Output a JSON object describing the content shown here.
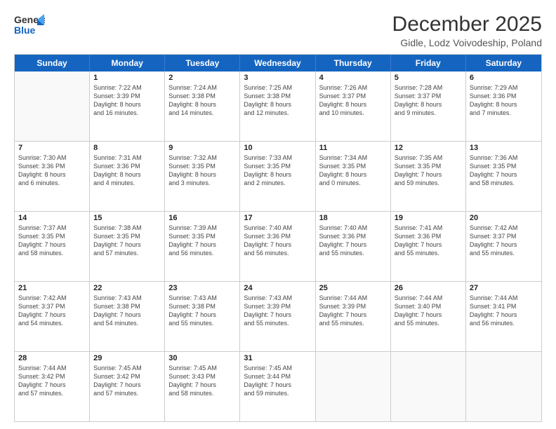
{
  "logo": {
    "line1": "General",
    "line2": "Blue"
  },
  "title": "December 2025",
  "subtitle": "Gidle, Lodz Voivodeship, Poland",
  "header_days": [
    "Sunday",
    "Monday",
    "Tuesday",
    "Wednesday",
    "Thursday",
    "Friday",
    "Saturday"
  ],
  "rows": [
    [
      {
        "day": "",
        "text": "",
        "empty": true
      },
      {
        "day": "1",
        "text": "Sunrise: 7:22 AM\nSunset: 3:39 PM\nDaylight: 8 hours\nand 16 minutes."
      },
      {
        "day": "2",
        "text": "Sunrise: 7:24 AM\nSunset: 3:38 PM\nDaylight: 8 hours\nand 14 minutes."
      },
      {
        "day": "3",
        "text": "Sunrise: 7:25 AM\nSunset: 3:38 PM\nDaylight: 8 hours\nand 12 minutes."
      },
      {
        "day": "4",
        "text": "Sunrise: 7:26 AM\nSunset: 3:37 PM\nDaylight: 8 hours\nand 10 minutes."
      },
      {
        "day": "5",
        "text": "Sunrise: 7:28 AM\nSunset: 3:37 PM\nDaylight: 8 hours\nand 9 minutes."
      },
      {
        "day": "6",
        "text": "Sunrise: 7:29 AM\nSunset: 3:36 PM\nDaylight: 8 hours\nand 7 minutes."
      }
    ],
    [
      {
        "day": "7",
        "text": "Sunrise: 7:30 AM\nSunset: 3:36 PM\nDaylight: 8 hours\nand 6 minutes."
      },
      {
        "day": "8",
        "text": "Sunrise: 7:31 AM\nSunset: 3:36 PM\nDaylight: 8 hours\nand 4 minutes."
      },
      {
        "day": "9",
        "text": "Sunrise: 7:32 AM\nSunset: 3:35 PM\nDaylight: 8 hours\nand 3 minutes."
      },
      {
        "day": "10",
        "text": "Sunrise: 7:33 AM\nSunset: 3:35 PM\nDaylight: 8 hours\nand 2 minutes."
      },
      {
        "day": "11",
        "text": "Sunrise: 7:34 AM\nSunset: 3:35 PM\nDaylight: 8 hours\nand 0 minutes."
      },
      {
        "day": "12",
        "text": "Sunrise: 7:35 AM\nSunset: 3:35 PM\nDaylight: 7 hours\nand 59 minutes."
      },
      {
        "day": "13",
        "text": "Sunrise: 7:36 AM\nSunset: 3:35 PM\nDaylight: 7 hours\nand 58 minutes."
      }
    ],
    [
      {
        "day": "14",
        "text": "Sunrise: 7:37 AM\nSunset: 3:35 PM\nDaylight: 7 hours\nand 58 minutes."
      },
      {
        "day": "15",
        "text": "Sunrise: 7:38 AM\nSunset: 3:35 PM\nDaylight: 7 hours\nand 57 minutes."
      },
      {
        "day": "16",
        "text": "Sunrise: 7:39 AM\nSunset: 3:35 PM\nDaylight: 7 hours\nand 56 minutes."
      },
      {
        "day": "17",
        "text": "Sunrise: 7:40 AM\nSunset: 3:36 PM\nDaylight: 7 hours\nand 56 minutes."
      },
      {
        "day": "18",
        "text": "Sunrise: 7:40 AM\nSunset: 3:36 PM\nDaylight: 7 hours\nand 55 minutes."
      },
      {
        "day": "19",
        "text": "Sunrise: 7:41 AM\nSunset: 3:36 PM\nDaylight: 7 hours\nand 55 minutes."
      },
      {
        "day": "20",
        "text": "Sunrise: 7:42 AM\nSunset: 3:37 PM\nDaylight: 7 hours\nand 55 minutes."
      }
    ],
    [
      {
        "day": "21",
        "text": "Sunrise: 7:42 AM\nSunset: 3:37 PM\nDaylight: 7 hours\nand 54 minutes."
      },
      {
        "day": "22",
        "text": "Sunrise: 7:43 AM\nSunset: 3:38 PM\nDaylight: 7 hours\nand 54 minutes."
      },
      {
        "day": "23",
        "text": "Sunrise: 7:43 AM\nSunset: 3:38 PM\nDaylight: 7 hours\nand 55 minutes."
      },
      {
        "day": "24",
        "text": "Sunrise: 7:43 AM\nSunset: 3:39 PM\nDaylight: 7 hours\nand 55 minutes."
      },
      {
        "day": "25",
        "text": "Sunrise: 7:44 AM\nSunset: 3:39 PM\nDaylight: 7 hours\nand 55 minutes."
      },
      {
        "day": "26",
        "text": "Sunrise: 7:44 AM\nSunset: 3:40 PM\nDaylight: 7 hours\nand 55 minutes."
      },
      {
        "day": "27",
        "text": "Sunrise: 7:44 AM\nSunset: 3:41 PM\nDaylight: 7 hours\nand 56 minutes."
      }
    ],
    [
      {
        "day": "28",
        "text": "Sunrise: 7:44 AM\nSunset: 3:42 PM\nDaylight: 7 hours\nand 57 minutes."
      },
      {
        "day": "29",
        "text": "Sunrise: 7:45 AM\nSunset: 3:42 PM\nDaylight: 7 hours\nand 57 minutes."
      },
      {
        "day": "30",
        "text": "Sunrise: 7:45 AM\nSunset: 3:43 PM\nDaylight: 7 hours\nand 58 minutes."
      },
      {
        "day": "31",
        "text": "Sunrise: 7:45 AM\nSunset: 3:44 PM\nDaylight: 7 hours\nand 59 minutes."
      },
      {
        "day": "",
        "text": "",
        "empty": true
      },
      {
        "day": "",
        "text": "",
        "empty": true
      },
      {
        "day": "",
        "text": "",
        "empty": true
      }
    ]
  ]
}
